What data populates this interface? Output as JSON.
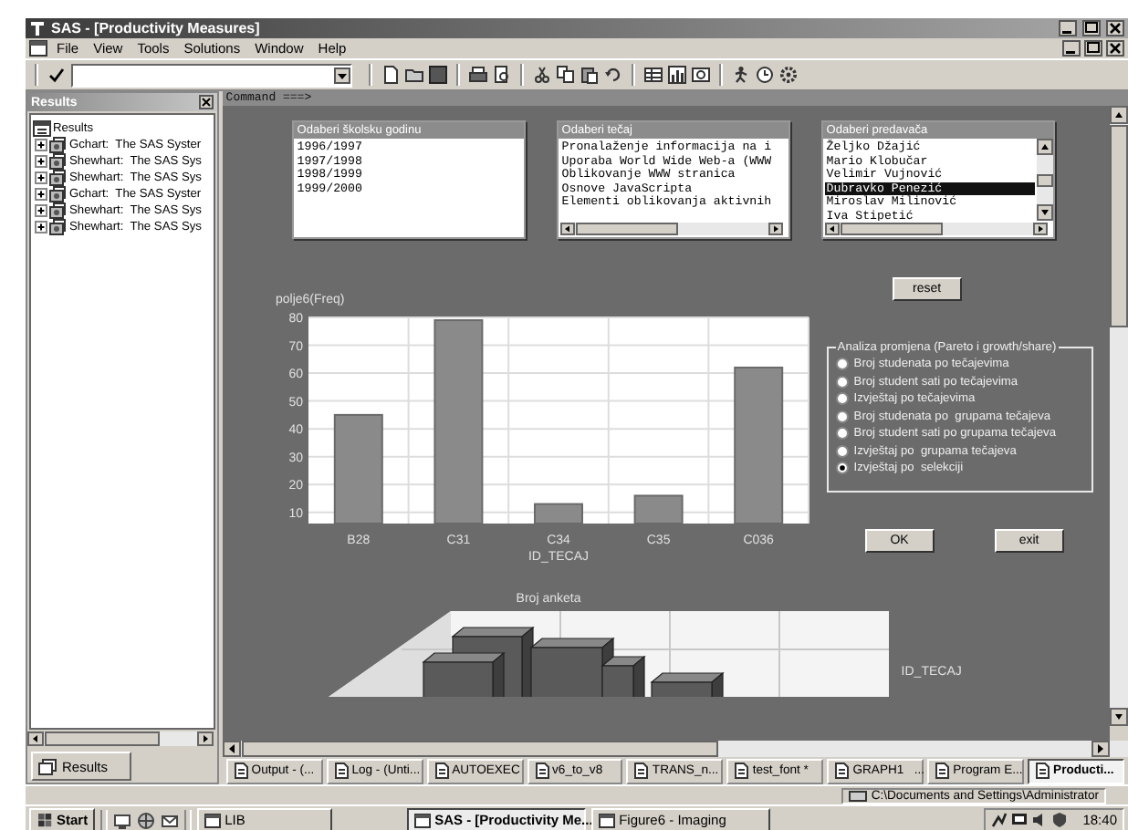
{
  "window": {
    "title": "SAS - [Productivity Measures]"
  },
  "menu": [
    "File",
    "View",
    "Tools",
    "Solutions",
    "Window",
    "Help"
  ],
  "results_panel": {
    "title": "Results",
    "tree": {
      "label": "Results",
      "children": [
        {
          "label": "Gchart:  The SAS Syster",
          "expanded": false
        },
        {
          "label": "Shewhart:  The SAS Sys",
          "expanded": false
        },
        {
          "label": "Shewhart:  The SAS Sys",
          "expanded": false
        },
        {
          "label": "Gchart:  The SAS Syster",
          "expanded": false
        },
        {
          "label": "Shewhart:  The SAS Sys",
          "expanded": false
        },
        {
          "label": "Shewhart:  The SAS Sys",
          "expanded": false
        }
      ]
    },
    "tab": "Results"
  },
  "command_line": "Command ===>",
  "listboxes": [
    {
      "title": "Odaberi školsku godinu",
      "items": [
        {
          "label": "1996/1997",
          "selected": false
        },
        {
          "label": "1997/1998",
          "selected": false
        },
        {
          "label": "1998/1999",
          "selected": false
        },
        {
          "label": "1999/2000",
          "selected": false
        }
      ]
    },
    {
      "title": "Odaberi tečaj",
      "items": [
        {
          "label": "Pronalaženje informacija na i",
          "selected": false
        },
        {
          "label": "Uporaba World Wide Web-a (WWW",
          "selected": false
        },
        {
          "label": "Oblikovanje WWW stranica",
          "selected": false
        },
        {
          "label": "Osnove JavaScripta",
          "selected": false
        },
        {
          "label": "Elementi oblikovanja aktivnih",
          "selected": false
        }
      ]
    },
    {
      "title": "Odaberi predavača",
      "items": [
        {
          "label": "Željko Džajić",
          "selected": false
        },
        {
          "label": "Mario Klobučar",
          "selected": false
        },
        {
          "label": "Velimir Vujnović",
          "selected": false
        },
        {
          "label": "Dubravko Penezić",
          "selected": true
        },
        {
          "label": "Miroslav Milinović",
          "selected": false
        },
        {
          "label": "Iva Stipetić",
          "selected": false
        }
      ]
    }
  ],
  "reset_button": "reset",
  "chart": {
    "chart_data": {
      "type": "bar",
      "xlabel": "ID_TECAJ",
      "ylabel": "polje6(Freq)",
      "categories": [
        "B28",
        "C31",
        "C34",
        "C35",
        "C036"
      ],
      "values": [
        45,
        79,
        13,
        16,
        62
      ],
      "ylim": [
        6,
        80
      ],
      "yticks": [
        10,
        20,
        30,
        40,
        50,
        60,
        70,
        80
      ],
      "grid": true
    }
  },
  "analysis_group": {
    "title": "Analiza promjena (Pareto i growth/share)",
    "options": [
      {
        "label": "Broj studenata po tečajevima",
        "selected": false
      },
      {
        "label": "Broj student sati po tečajevima",
        "selected": false
      },
      {
        "label": "Izvještaj po tečajevima",
        "selected": false
      },
      {
        "label": "Broj studenata po  grupama tečajeva",
        "selected": false
      },
      {
        "label": "Broj student sati po grupama tečajeva",
        "selected": false
      },
      {
        "label": "Izvještaj po  grupama tečajeva",
        "selected": false
      },
      {
        "label": "Izvještaj po  selekciji",
        "selected": true
      }
    ]
  },
  "ok_button": "OK",
  "exit_button": "exit",
  "chart_3d": {
    "title": "Broj anketa",
    "axis_label": "ID_TECAJ"
  },
  "tabs": [
    {
      "label": "Output - (...",
      "selected": false
    },
    {
      "label": "Log - (Unti...",
      "selected": false
    },
    {
      "label": "AUTOEXEC",
      "selected": false
    },
    {
      "label": "v6_to_v8",
      "selected": false
    },
    {
      "label": "TRANS_n...",
      "selected": false
    },
    {
      "label": "test_font *",
      "selected": false
    },
    {
      "label": "GRAPH1   ...",
      "selected": false
    },
    {
      "label": "Program E...",
      "selected": false
    },
    {
      "label": "Producti...",
      "selected": true
    }
  ],
  "status_bar": {
    "path": "C:\\Documents and Settings\\Administrator"
  },
  "taskbar": {
    "start": "Start",
    "items": [
      {
        "label": "LIB",
        "selected": false
      },
      {
        "label": "SAS - [Productivity Me...",
        "selected": true
      },
      {
        "label": "Figure6 - Imaging",
        "selected": false
      }
    ],
    "clock": "18:40"
  }
}
